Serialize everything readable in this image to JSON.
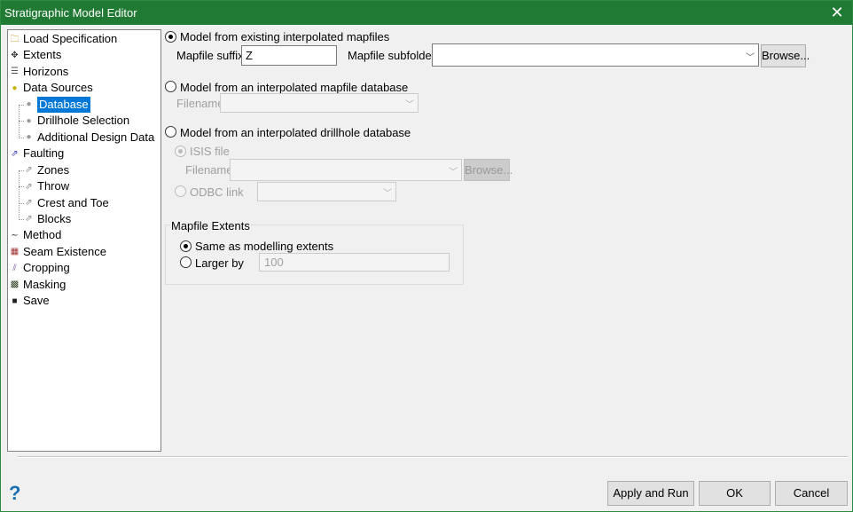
{
  "window": {
    "title": "Stratigraphic Model Editor",
    "close": "✕"
  },
  "tree": [
    {
      "label": "Load Specification",
      "icon": "folder-icon"
    },
    {
      "label": "Extents",
      "icon": "move-icon"
    },
    {
      "label": "Horizons",
      "icon": "layers-icon"
    },
    {
      "label": "Data Sources",
      "icon": "database-icon"
    },
    {
      "label": "Database",
      "icon": "database-icon",
      "selected": true
    },
    {
      "label": "Drillhole Selection",
      "icon": "database-icon"
    },
    {
      "label": "Additional Design Data",
      "icon": "database-icon"
    },
    {
      "label": "Faulting",
      "icon": "fault-icon"
    },
    {
      "label": "Zones",
      "icon": "fault-icon"
    },
    {
      "label": "Throw",
      "icon": "fault-icon"
    },
    {
      "label": "Crest and Toe",
      "icon": "fault-icon"
    },
    {
      "label": "Blocks",
      "icon": "fault-icon"
    },
    {
      "label": "Method",
      "icon": "wave-icon"
    },
    {
      "label": "Seam Existence",
      "icon": "seam-icon"
    },
    {
      "label": "Cropping",
      "icon": "cropping-icon"
    },
    {
      "label": "Masking",
      "icon": "masking-icon"
    },
    {
      "label": "Save",
      "icon": "save-icon"
    }
  ],
  "options": {
    "existing": {
      "label": "Model from existing interpolated mapfiles",
      "suffix_label": "Mapfile suffix",
      "suffix_value": "Z",
      "subfolder_label": "Mapfile subfolder",
      "subfolder_value": "",
      "browse": "Browse..."
    },
    "mapfile_db": {
      "label": "Model from an interpolated mapfile database",
      "filename_label": "Filename"
    },
    "drillhole_db": {
      "label": "Model from an interpolated drillhole database",
      "isis_label": "ISIS file",
      "filename_label": "Filename",
      "browse": "Browse...",
      "odbc_label": "ODBC link"
    }
  },
  "extents": {
    "title": "Mapfile Extents",
    "same": "Same as modelling extents",
    "larger": "Larger by",
    "larger_value": "100"
  },
  "footer": {
    "help": "?",
    "apply": "Apply and Run",
    "ok": "OK",
    "cancel": "Cancel"
  }
}
